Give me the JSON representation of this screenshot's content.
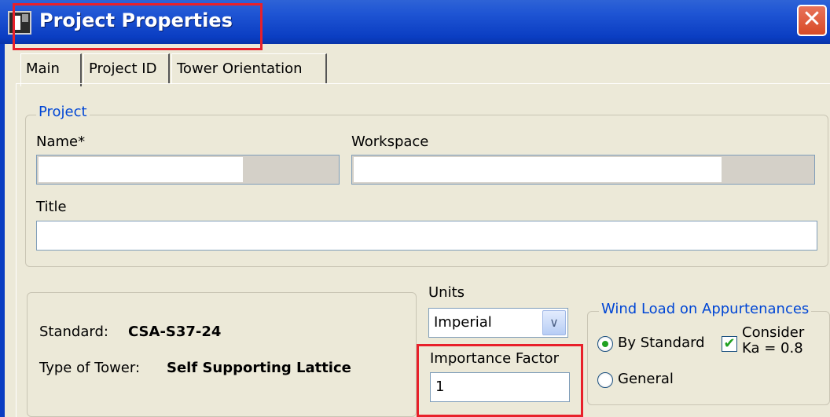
{
  "window": {
    "title": "Project Properties",
    "close_glyph": "✕"
  },
  "tabs": [
    {
      "label": "Main"
    },
    {
      "label": "Project ID"
    },
    {
      "label": "Tower Orientation"
    }
  ],
  "project_group": {
    "label": "Project",
    "name_label": "Name*",
    "workspace_label": "Workspace",
    "title_label": "Title",
    "name_value": "",
    "workspace_value": "",
    "title_value": ""
  },
  "info": {
    "standard_label": "Standard:",
    "standard_value": "CSA-S37-24",
    "tower_label": "Type of Tower:",
    "tower_value": "Self Supporting Lattice"
  },
  "units": {
    "label": "Units",
    "selected": "Imperial"
  },
  "importance_factor": {
    "label": "Importance Factor",
    "value": "1"
  },
  "wind_group": {
    "label": "Wind Load on Appurtenances",
    "by_standard": "By Standard",
    "general": "General",
    "consider_line1": "Consider",
    "consider_line2": "Ka = 0.8",
    "selected": "By Standard",
    "consider_checked": true
  },
  "colors": {
    "highlight": "#E8202A",
    "group_label": "#0046D5",
    "title_bar": "#0A3DC2"
  },
  "icons": [
    "app-icon",
    "close-icon",
    "dropdown-arrow-icon",
    "check-icon"
  ]
}
